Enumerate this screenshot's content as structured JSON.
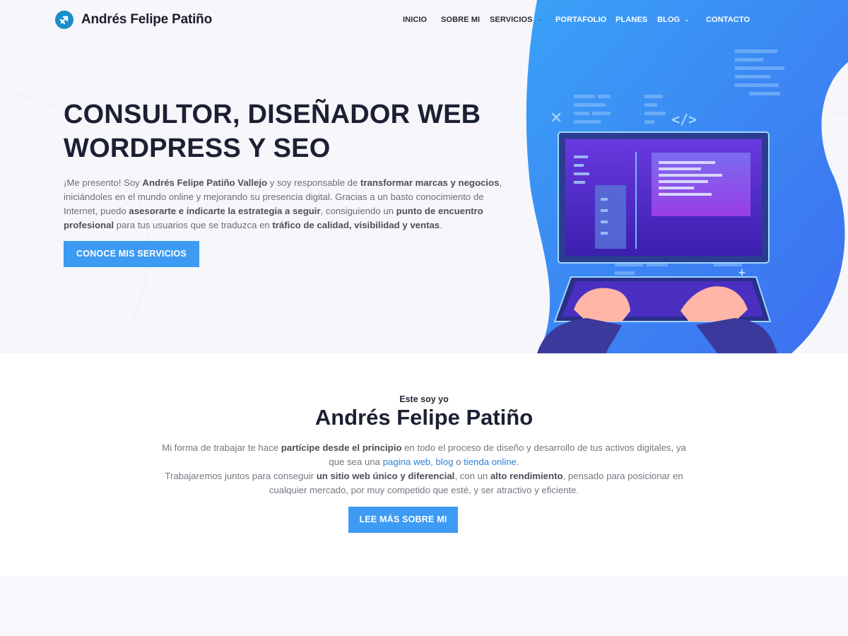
{
  "brand": {
    "name": "Andrés Felipe Patiño"
  },
  "nav": {
    "items": [
      {
        "label": "INICIO"
      },
      {
        "label": "SOBRE MI"
      },
      {
        "label": "SERVICIOS"
      },
      {
        "label": "PORTAFOLIO"
      },
      {
        "label": "PLANES"
      },
      {
        "label": "BLOG"
      },
      {
        "label": "CONTACTO"
      }
    ]
  },
  "hero": {
    "title_line1": "CONSULTOR, DISEÑADOR WEB",
    "title_line2": "WORDPRESS Y SEO",
    "p1": "¡Me presento! Soy ",
    "b1": "Andrés Felipe Patiño Vallejo",
    "p2": " y soy responsable de ",
    "b2": "transformar marcas y negocios",
    "p3": ", iniciándoles en el mundo online y mejorando su presencia digital. Gracias a un basto conocimiento de Internet, puedo ",
    "b3": "asesorarte e indicarte la estrategia a seguir",
    "p4": ", consiguiendo un ",
    "b4": "punto de encuentro profesional",
    "p5": " para tus usuarios que se traduzca en ",
    "b5": "tráfico de calidad, visibilidad y ventas",
    "p6": ".",
    "cta": "CONOCE MIS SERVICIOS"
  },
  "about": {
    "kicker": "Este soy yo",
    "title": "Andrés Felipe Patiño",
    "t1": "Mi forma de trabajar te hace ",
    "b1": "partícipe desde el principio",
    "t2": " en todo el proceso de diseño y desarrollo de tus activos digitales, ya que sea una ",
    "l1": "pagina web",
    "t3": ", ",
    "l2": "blog",
    "t4": " o ",
    "l3": "tienda online",
    "t5": ".",
    "t6": "Trabajaremos juntos para conseguir ",
    "b2": "un sitio web único y diferencial",
    "t7": ", con un ",
    "b3": "alto rendimiento",
    "t8": ", pensado para posicionar en cualquier mercado, por muy competido que esté, y ser atractivo y eficiente.",
    "cta": "LEE MÁS SOBRE MI"
  },
  "colors": {
    "accent": "#3d9bf3",
    "heading": "#1c2033",
    "blob": "#3d8ef6",
    "screen": "#5a2fd0"
  }
}
